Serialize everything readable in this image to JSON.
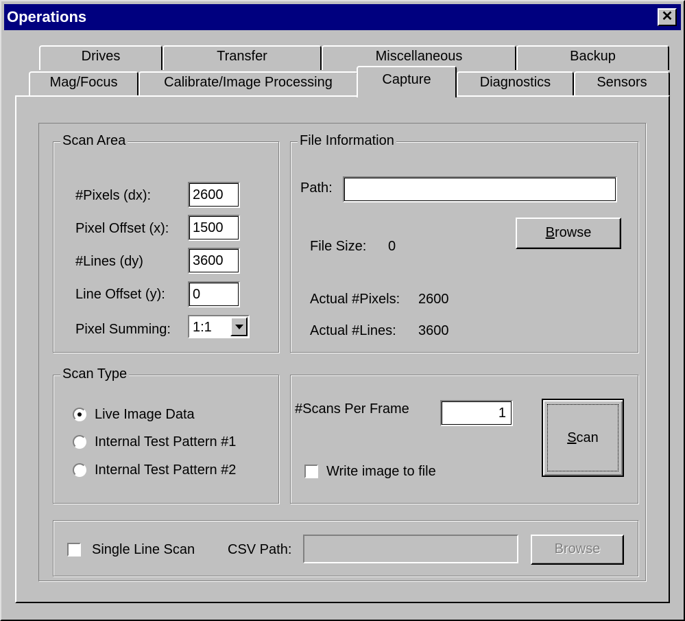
{
  "window": {
    "title": "Operations",
    "close_glyph": "✕"
  },
  "tabs": {
    "row_back": [
      "Drives",
      "Transfer",
      "Miscellaneous",
      "Backup"
    ],
    "row_front": [
      "Mag/Focus",
      "Calibrate/Image Processing",
      "Capture",
      "Diagnostics",
      "Sensors"
    ],
    "active": "Capture"
  },
  "scan_area": {
    "legend": "Scan Area",
    "pixels_label": "#Pixels (dx):",
    "pixels_value": "2600",
    "pixel_offset_label": "Pixel Offset (x):",
    "pixel_offset_value": "1500",
    "lines_label": "#Lines  (dy)",
    "lines_value": "3600",
    "line_offset_label": "Line Offset (y):",
    "line_offset_value": "0",
    "pixel_summing_label": "Pixel Summing:",
    "pixel_summing_value": "1:1"
  },
  "file_info": {
    "legend": "File Information",
    "path_label": "Path:",
    "path_value": "",
    "browse_label": "Browse",
    "file_size_label": "File Size:",
    "file_size_value": "0",
    "actual_pixels_label": "Actual #Pixels:",
    "actual_pixels_value": "2600",
    "actual_lines_label": "Actual #Lines:",
    "actual_lines_value": "3600"
  },
  "scan_type": {
    "legend": "Scan Type",
    "options": [
      "Live Image Data",
      "Internal Test Pattern #1",
      "Internal Test Pattern #2"
    ],
    "selected": "Live Image Data"
  },
  "scan_control": {
    "scans_per_frame_label": "#Scans Per Frame",
    "scans_per_frame_value": "1",
    "write_to_file_label": "Write image to file",
    "write_to_file_checked": false,
    "scan_button_label": "Scan"
  },
  "single_line": {
    "single_line_label": "Single Line Scan",
    "single_line_checked": false,
    "csv_path_label": "CSV Path:",
    "csv_path_value": "",
    "browse_label": "Browse"
  }
}
